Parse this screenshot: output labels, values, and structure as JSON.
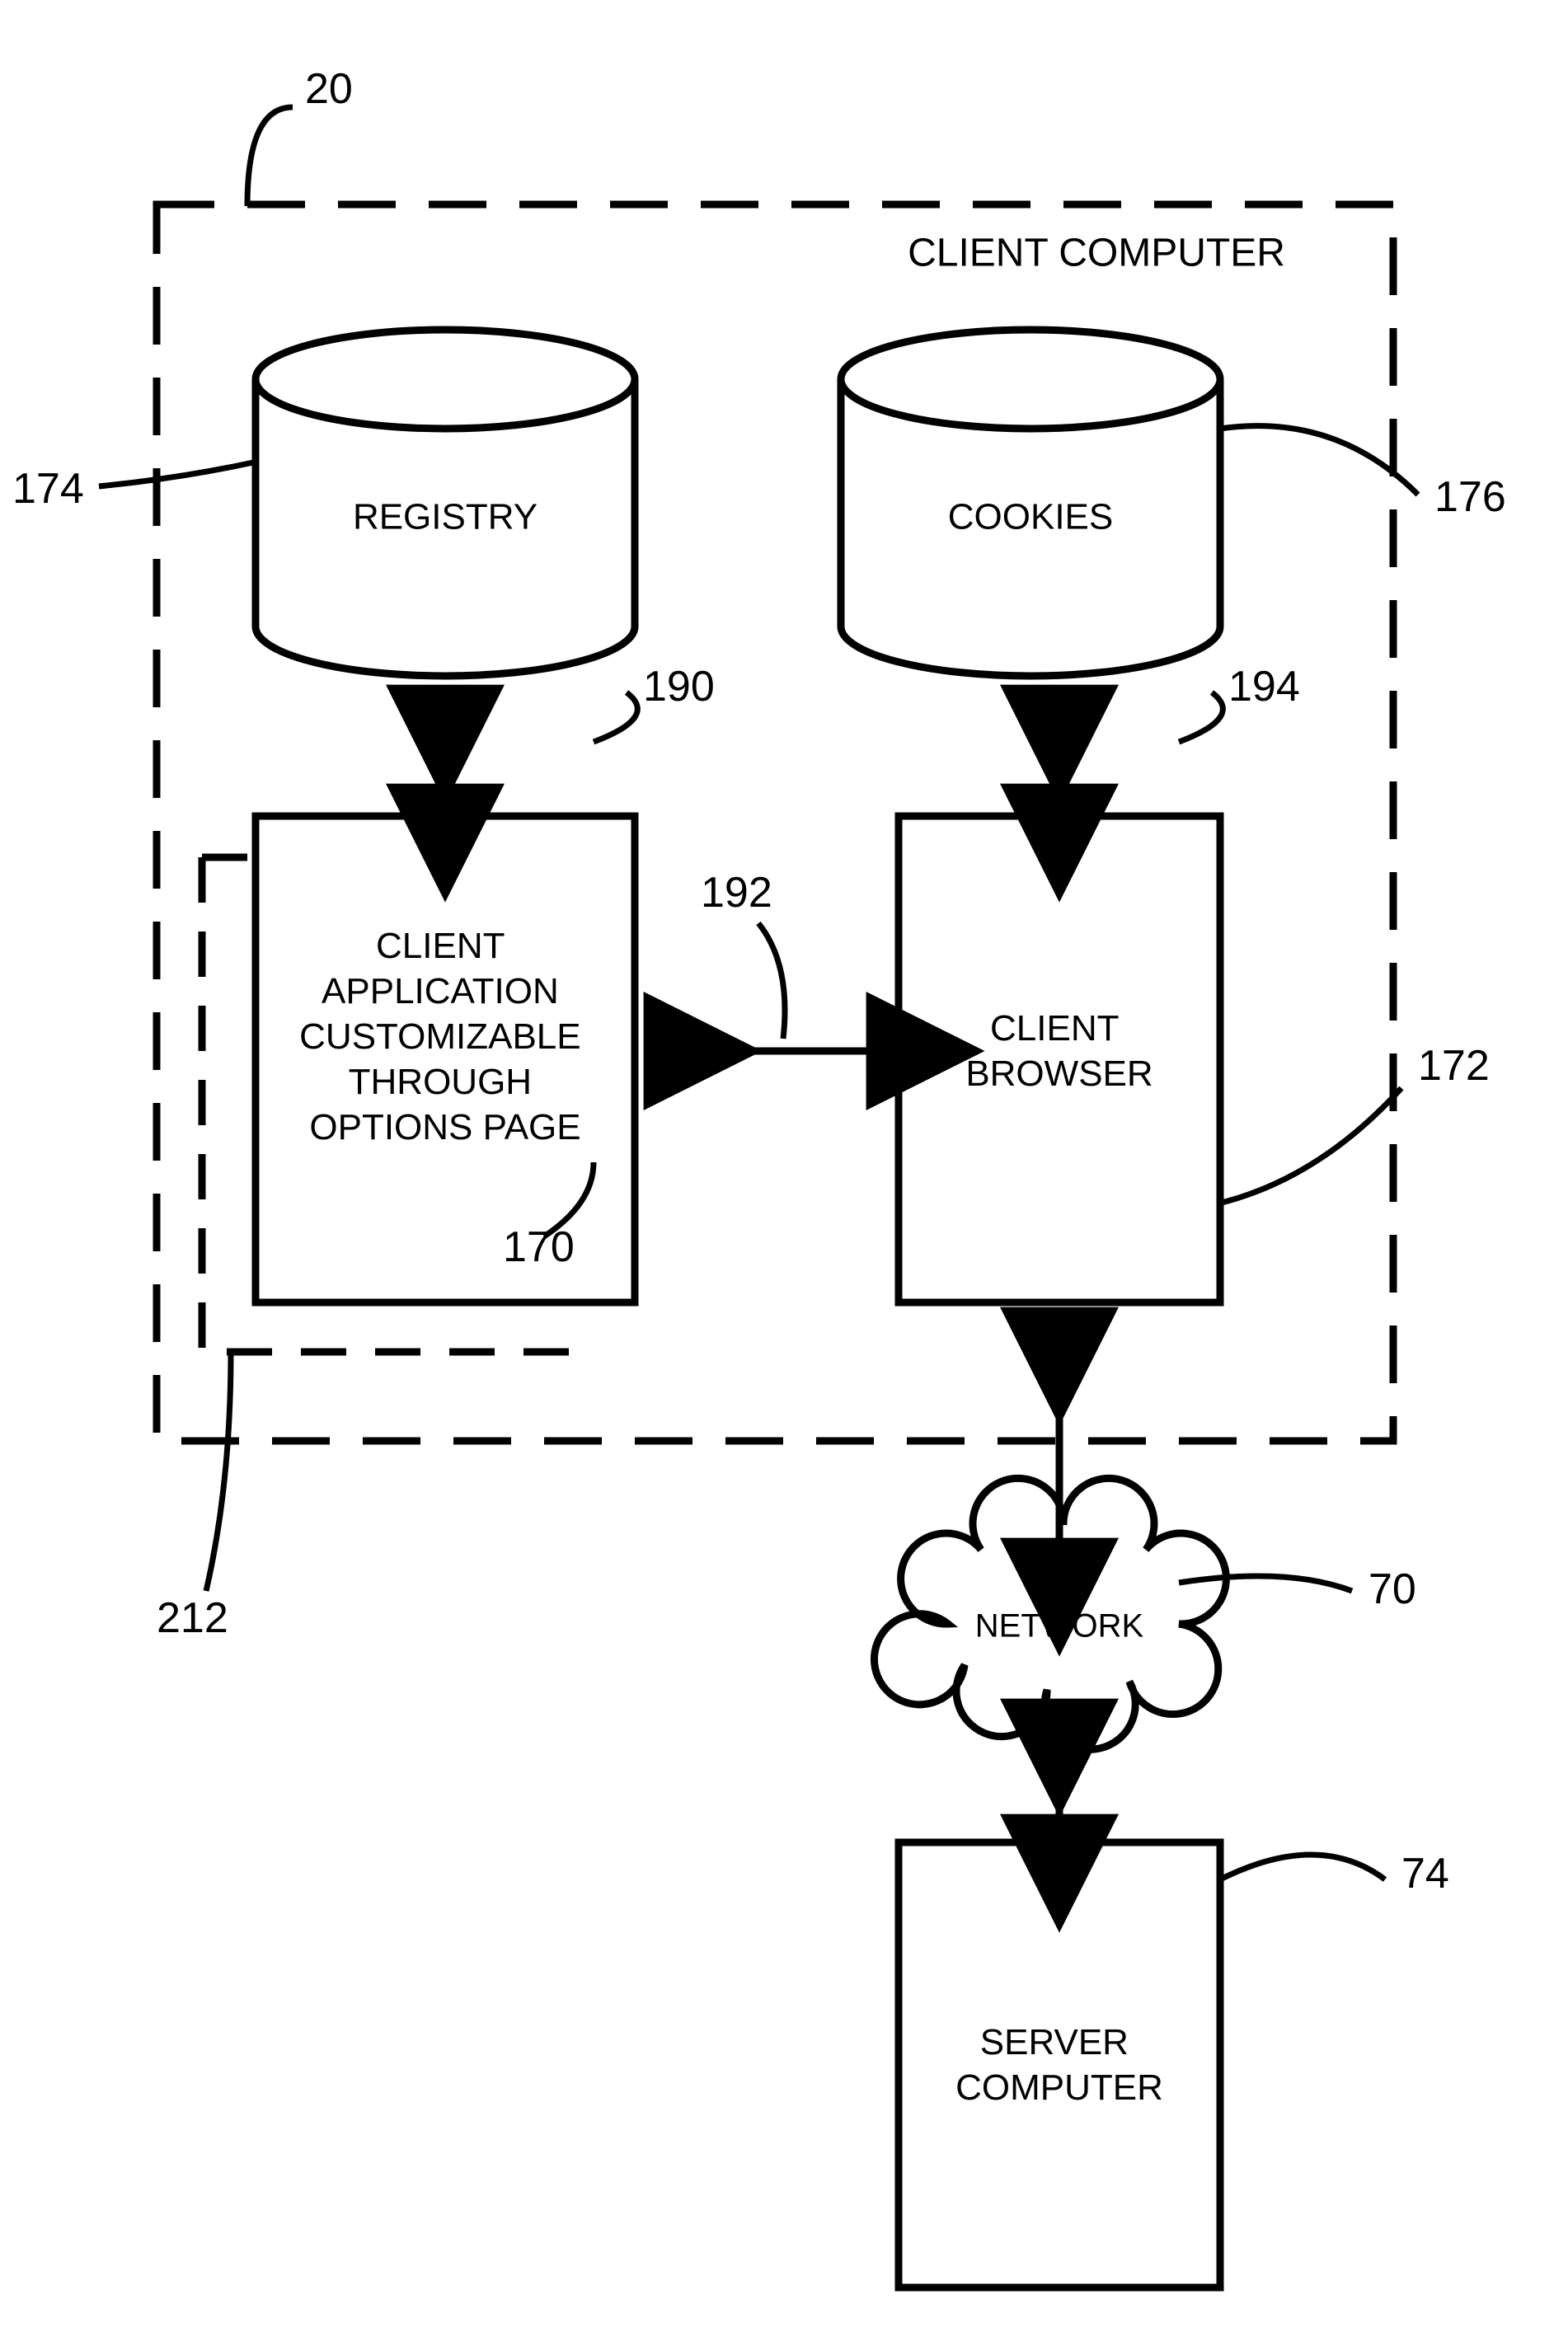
{
  "title": "CLIENT COMPUTER",
  "blocks": {
    "registry": "REGISTRY",
    "cookies": "COOKIES",
    "clientApp": [
      "CLIENT",
      "APPLICATION",
      "CUSTOMIZABLE",
      "THROUGH",
      "OPTIONS PAGE"
    ],
    "clientBrowser": [
      "CLIENT",
      "BROWSER"
    ],
    "network": "NETWORK",
    "server": [
      "SERVER",
      "COMPUTER"
    ]
  },
  "refs": {
    "r20": "20",
    "r174": "174",
    "r176": "176",
    "r190": "190",
    "r194": "194",
    "r192": "192",
    "r170": "170",
    "r172": "172",
    "r212": "212",
    "r70": "70",
    "r74": "74"
  }
}
